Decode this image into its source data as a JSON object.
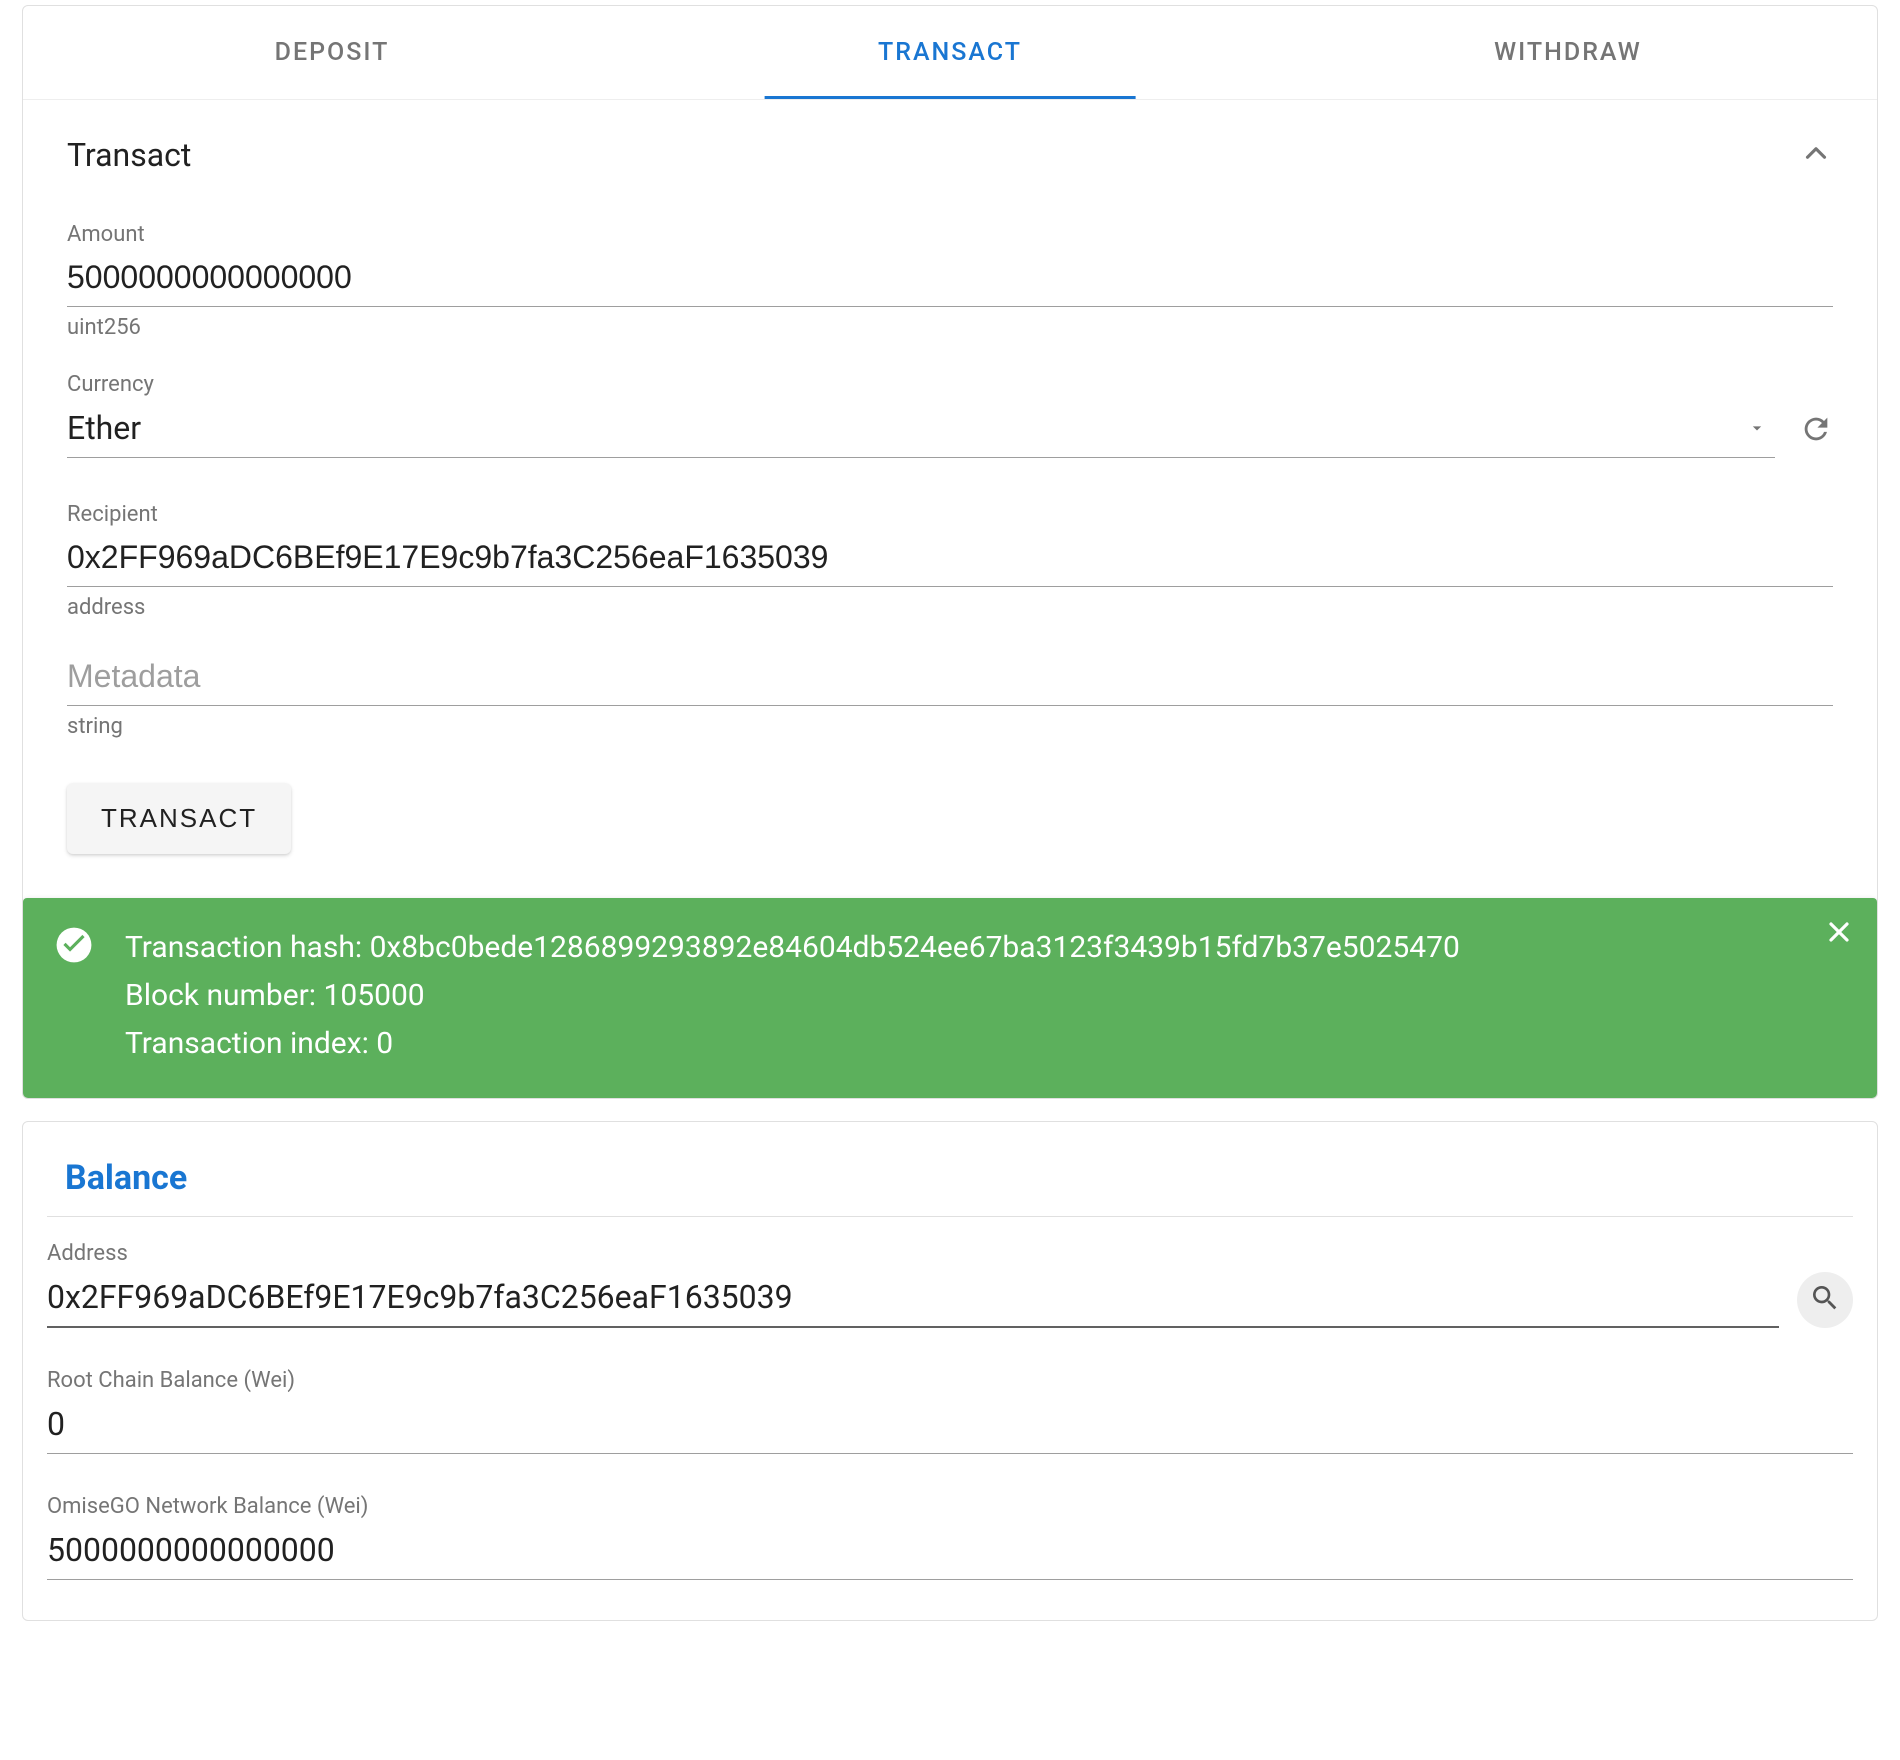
{
  "tabs": {
    "deposit": "Deposit",
    "transact": "Transact",
    "withdraw": "Withdraw"
  },
  "transact_panel": {
    "title": "Transact",
    "amount": {
      "label": "Amount",
      "value": "5000000000000000",
      "hint": "uint256"
    },
    "currency": {
      "label": "Currency",
      "value": "Ether"
    },
    "recipient": {
      "label": "Recipient",
      "value": "0x2FF969aDC6BEf9E17E9c9b7fa3C256eaF1635039",
      "hint": "address"
    },
    "metadata": {
      "placeholder": "Metadata",
      "hint": "string"
    },
    "button": "Transact"
  },
  "alert": {
    "hash_label": "Transaction hash: ",
    "hash": "0x8bc0bede1286899293892e84604db524ee67ba3123f3439b15fd7b37e5025470",
    "block_label": "Block number: ",
    "block": "105000",
    "index_label": "Transaction index: ",
    "index": "0"
  },
  "balance": {
    "title": "Balance",
    "address": {
      "label": "Address",
      "value": "0x2FF969aDC6BEf9E17E9c9b7fa3C256eaF1635039"
    },
    "root": {
      "label": "Root Chain Balance (Wei)",
      "value": "0"
    },
    "omisego": {
      "label": "OmiseGO Network Balance (Wei)",
      "value": "5000000000000000"
    }
  }
}
